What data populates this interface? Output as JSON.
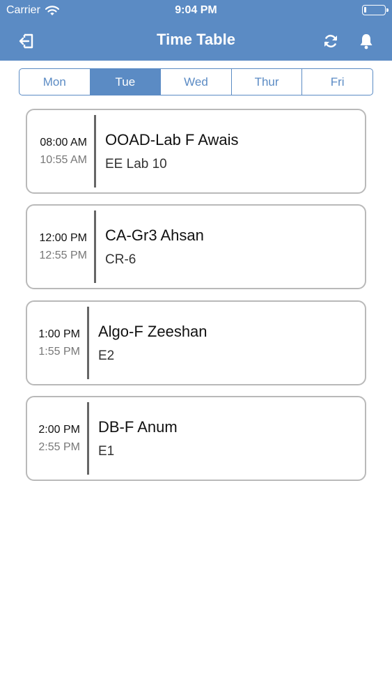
{
  "status_bar": {
    "carrier": "Carrier",
    "time": "9:04 PM",
    "battery_level": 0.1
  },
  "nav": {
    "title": "Time Table",
    "icons": [
      "logout-icon",
      "refresh-icon",
      "bell-icon"
    ]
  },
  "days": [
    "Mon",
    "Tue",
    "Wed",
    "Thur",
    "Fri"
  ],
  "selected_day": "Tue",
  "classes": [
    {
      "start": "08:00 AM",
      "end": "10:55 AM",
      "course": "OOAD-Lab F Awais",
      "room": "EE Lab 10"
    },
    {
      "start": "12:00 PM",
      "end": "12:55 PM",
      "course": "CA-Gr3 Ahsan",
      "room": "CR-6"
    },
    {
      "start": "1:00 PM",
      "end": "1:55 PM",
      "course": "Algo-F Zeeshan",
      "room": "E2"
    },
    {
      "start": "2:00 PM",
      "end": "2:55 PM",
      "course": "DB-F Anum",
      "room": "E1"
    }
  ],
  "colors": {
    "accent": "#5b8bc4",
    "card_border": "#b9b9b9",
    "divider": "#666666"
  }
}
